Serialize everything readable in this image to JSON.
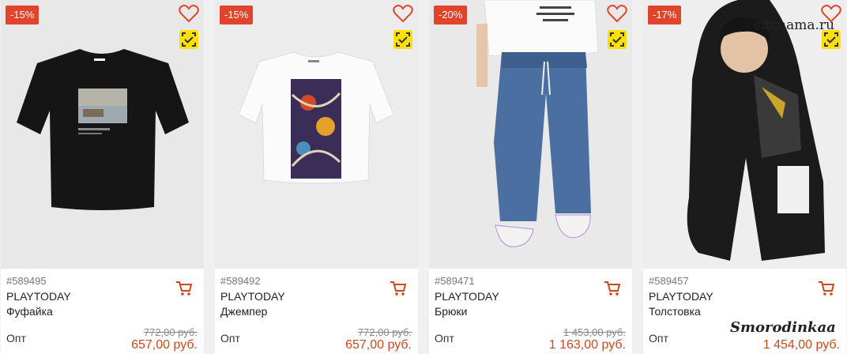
{
  "products": [
    {
      "discount": "-15%",
      "sku": "#589495",
      "brand": "PLAYTODAY",
      "type": "Фуфайка",
      "price_label": "Опт",
      "old_price": "772,00 руб.",
      "price": "657,00 руб."
    },
    {
      "discount": "-15%",
      "sku": "#589492",
      "brand": "PLAYTODAY",
      "type": "Джемпер",
      "price_label": "Опт",
      "old_price": "772,00 руб.",
      "price": "657,00 руб."
    },
    {
      "discount": "-20%",
      "sku": "#589471",
      "brand": "PLAYTODAY",
      "type": "Брюки",
      "price_label": "Опт",
      "old_price": "1 453,00 руб.",
      "price": "1 163,00 руб."
    },
    {
      "discount": "-17%",
      "sku": "#589457",
      "brand": "PLAYTODAY",
      "type": "Толстовка",
      "price_label": "Опт",
      "old_price": "",
      "price": "1 454,00 руб."
    }
  ],
  "watermarks": {
    "site": "sibmama.ru",
    "user": "Smorodinkaa"
  },
  "colors": {
    "badge": "#e2442b",
    "price": "#c94a1a",
    "compare": "#ffe000"
  }
}
